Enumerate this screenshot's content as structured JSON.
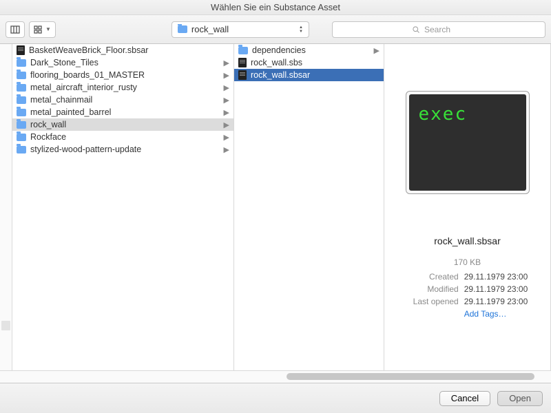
{
  "window": {
    "title": "Wählen Sie ein Substance Asset"
  },
  "path": {
    "current": "rock_wall"
  },
  "search": {
    "placeholder": "Search"
  },
  "colA": {
    "items": [
      {
        "label": "BasketWeaveBrick_Floor.sbsar",
        "icon": "doc",
        "expandable": false
      },
      {
        "label": "Dark_Stone_Tiles",
        "icon": "folder",
        "expandable": true
      },
      {
        "label": "flooring_boards_01_MASTER",
        "icon": "folder",
        "expandable": true
      },
      {
        "label": "metal_aircraft_interior_rusty",
        "icon": "folder",
        "expandable": true
      },
      {
        "label": "metal_chainmail",
        "icon": "folder",
        "expandable": true
      },
      {
        "label": "metal_painted_barrel",
        "icon": "folder",
        "expandable": true
      },
      {
        "label": "rock_wall",
        "icon": "folder",
        "expandable": true,
        "selected": true
      },
      {
        "label": "Rockface",
        "icon": "folder",
        "expandable": true
      },
      {
        "label": "stylized-wood-pattern-update",
        "icon": "folder",
        "expandable": true
      }
    ]
  },
  "colB": {
    "items": [
      {
        "label": "dependencies",
        "icon": "folder",
        "expandable": true
      },
      {
        "label": "rock_wall.sbs",
        "icon": "doc",
        "expandable": false
      },
      {
        "label": "rock_wall.sbsar",
        "icon": "doc",
        "expandable": false,
        "selected": true
      }
    ]
  },
  "preview": {
    "exec_label": "exec",
    "filename": "rock_wall.sbsar",
    "size": "170 KB",
    "rows": {
      "created_label": "Created",
      "created_value": "29.11.1979 23:00",
      "modified_label": "Modified",
      "modified_value": "29.11.1979 23:00",
      "opened_label": "Last opened",
      "opened_value": "29.11.1979 23:00"
    },
    "add_tags": "Add Tags…"
  },
  "footer": {
    "cancel": "Cancel",
    "open": "Open"
  }
}
